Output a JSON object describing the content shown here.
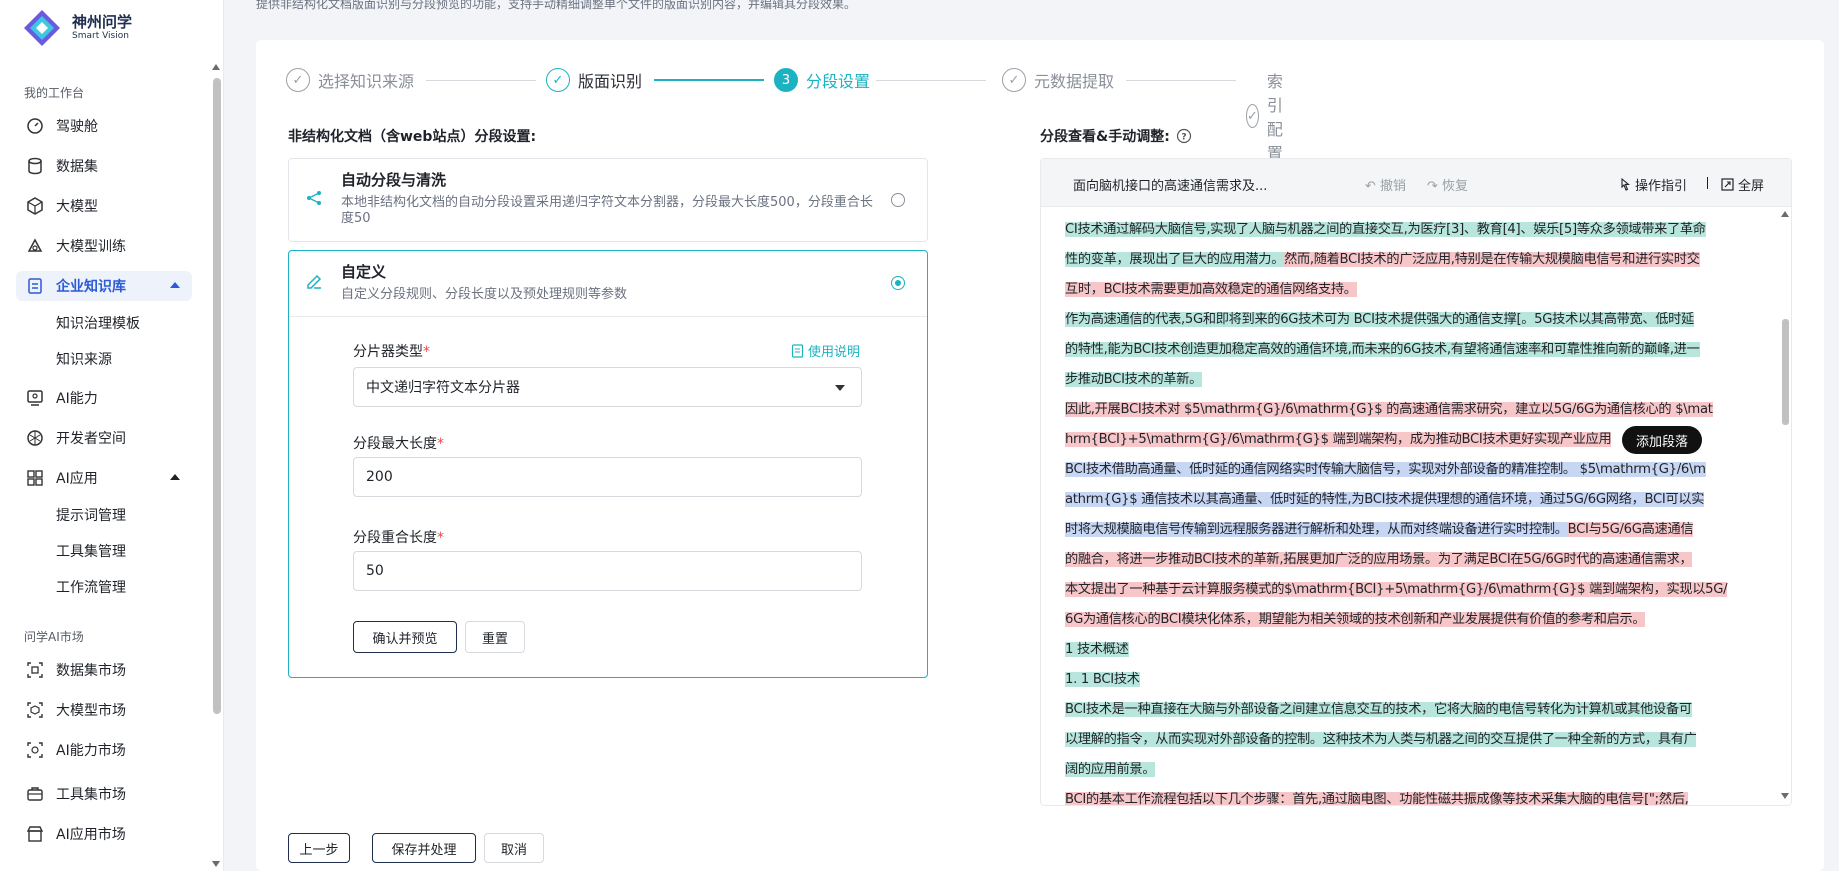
{
  "brand": {
    "name": "神州问学",
    "sub": "Smart Vision"
  },
  "top_desc": "提供非结构化文档版面识别与分段预览的功能，支持手动精细调整单个文件的版面识别内容，并编辑其分段效果。",
  "sidebar": {
    "section1": "我的工作台",
    "items": [
      {
        "label": "驾驶舱",
        "icon": "dashboard-icon"
      },
      {
        "label": "数据集",
        "icon": "database-icon"
      },
      {
        "label": "大模型",
        "icon": "cube-icon"
      },
      {
        "label": "大模型训练",
        "icon": "training-icon"
      },
      {
        "label": "企业知识库",
        "icon": "knowledge-icon"
      },
      {
        "label": "AI能力",
        "icon": "ai-capability-icon"
      },
      {
        "label": "开发者空间",
        "icon": "developer-icon"
      },
      {
        "label": "AI应用",
        "icon": "grid-icon"
      }
    ],
    "kb_subs": [
      "知识治理模板",
      "知识来源"
    ],
    "ai_app_subs": [
      "提示词管理",
      "工具集管理",
      "工作流管理"
    ],
    "section2": "问学AI市场",
    "market": [
      {
        "label": "数据集市场",
        "icon": "dataset-market-icon"
      },
      {
        "label": "大模型市场",
        "icon": "model-market-icon"
      },
      {
        "label": "AI能力市场",
        "icon": "ai-market-icon"
      },
      {
        "label": "工具集市场",
        "icon": "toolbox-icon"
      },
      {
        "label": "AI应用市场",
        "icon": "store-icon"
      }
    ]
  },
  "steps": [
    {
      "label": "选择知识来源",
      "mark": "✓"
    },
    {
      "label": "版面识别",
      "mark": "✓"
    },
    {
      "label": "分段设置",
      "mark": "3"
    },
    {
      "label": "元数据提取",
      "mark": "✓"
    },
    {
      "label": "索引配置",
      "mark": "✓"
    }
  ],
  "left": {
    "section_title": "非结构化文档（含web站点）分段设置:",
    "auto": {
      "title": "自动分段与清洗",
      "desc": "本地非结构化文档的自动分段设置采用递归字符文本分割器，分段最大长度500，分段重合长度50"
    },
    "custom": {
      "title": "自定义",
      "desc": "自定义分段规则、分段长度以及预处理规则等参数"
    },
    "splitter_label": "分片器类型",
    "help": "使用说明",
    "splitter_value": "中文递归字符文本分片器",
    "max_len_label": "分段最大长度",
    "max_len_value": "200",
    "overlap_label": "分段重合长度",
    "overlap_value": "50",
    "confirm_btn": "确认并预览",
    "reset_btn": "重置"
  },
  "footer": {
    "prev": "上一步",
    "save": "保存并处理",
    "cancel": "取消"
  },
  "right": {
    "section_title": "分段查看&手动调整:",
    "doc_title": "面向脑机接口的高速通信需求及...",
    "undo": "撤销",
    "redo": "恢复",
    "guide": "操作指引",
    "fullscreen": "全屏",
    "add_segment": "添加段落"
  },
  "preview_lines": [
    [
      {
        "t": "CI技术通过解码大脑信号,实现了人脑与机器之间的直接交互,为医疗[3]、教育[4]、娱乐[5]等众多领域带来了革命",
        "c": "g"
      }
    ],
    [
      {
        "t": "性的变革，展现出了巨大的应用潜力。",
        "c": "g"
      },
      {
        "t": "然而,随着BCI技术的广泛应用,特别是在传输大规模脑电信号和进行实时交",
        "c": "r"
      }
    ],
    [
      {
        "t": "互时，BCI技术需要更加高效稳定的通信网络支持。",
        "c": "r"
      }
    ],
    [
      {
        "t": "作为高速通信的代表,5G和即将到来的6G技术可为 BCI技术提供强大的通信支撑[。5G技术以其高带宽、低时延",
        "c": "g"
      }
    ],
    [
      {
        "t": "的特性,能为BCI技术创造更加稳定高效的通信环境,而未来的6G技术,有望将通信速率和可靠性推向新的巅峰,进一",
        "c": "g"
      }
    ],
    [
      {
        "t": "步推动BCI技术的革新。",
        "c": "g"
      }
    ],
    [
      {
        "t": "因此,开展BCI技术对 $5\\mathrm{G}/6\\mathrm{G}$ 的高速通信需求研究，建立以5G/6G为通信核心的 $\\mat",
        "c": "r"
      }
    ],
    [
      {
        "t": "hrm{BCI}+5\\mathrm{G}/6\\mathrm{G}$ 端到端架构，成为推动BCI技术更好实现产业应用",
        "c": "r"
      }
    ],
    [
      {
        "t": "BCI技术借助高通量、低时延的通信网络实时传输大脑信号，实现对外部设备的精准控制。 $5\\mathrm{G}/6\\m",
        "c": "b"
      }
    ],
    [
      {
        "t": "athrm{G}$ 通信技术以其高通量、低时延的特性,为BCI技术提供理想的通信环境，通过5G/6G网络，BCI可以实",
        "c": "b"
      }
    ],
    [
      {
        "t": "时将大规模脑电信号传输到远程服务器进行解析和处理，从而对终端设备进行实时控制。",
        "c": "b"
      },
      {
        "t": "BCI与5G/6G高速通信",
        "c": "r"
      }
    ],
    [
      {
        "t": "的融合，将进一步推动BCI技术的革新,拓展更加广泛的应用场景。为了满足BCI在5G/6G时代的高速通信需求，",
        "c": "r"
      }
    ],
    [
      {
        "t": "本文提出了一种基于云计算服务模式的$\\mathrm{BCI}+5\\mathrm{G}/6\\mathrm{G}$ 端到端架构，实现以5G/",
        "c": "r"
      }
    ],
    [
      {
        "t": "6G为通信核心的BCI模块化体系，期望能为相关领域的技术创新和产业发展提供有价值的参考和启示。",
        "c": "r"
      }
    ],
    [
      {
        "t": "1 技术概述",
        "c": "g"
      }
    ],
    [
      {
        "t": "1. 1 BCI技术",
        "c": "g"
      }
    ],
    [
      {
        "t": "BCI技术是一种直接在大脑与外部设备之间建立信息交互的技术，它将大脑的电信号转化为计算机或其他设备可",
        "c": "g"
      }
    ],
    [
      {
        "t": "以理解的指令，从而实现对外部设备的控制。这种技术为人类与机器之间的交互提供了一种全新的方式，具有广",
        "c": "g"
      }
    ],
    [
      {
        "t": "阔的应用前景。",
        "c": "g"
      }
    ],
    [
      {
        "t": "BCI的基本工作流程包括以下几个步骤：首先,通过脑电图、功能性磁共振成像等技术采集大脑的电信号[\";然后,",
        "c": "r"
      }
    ]
  ]
}
